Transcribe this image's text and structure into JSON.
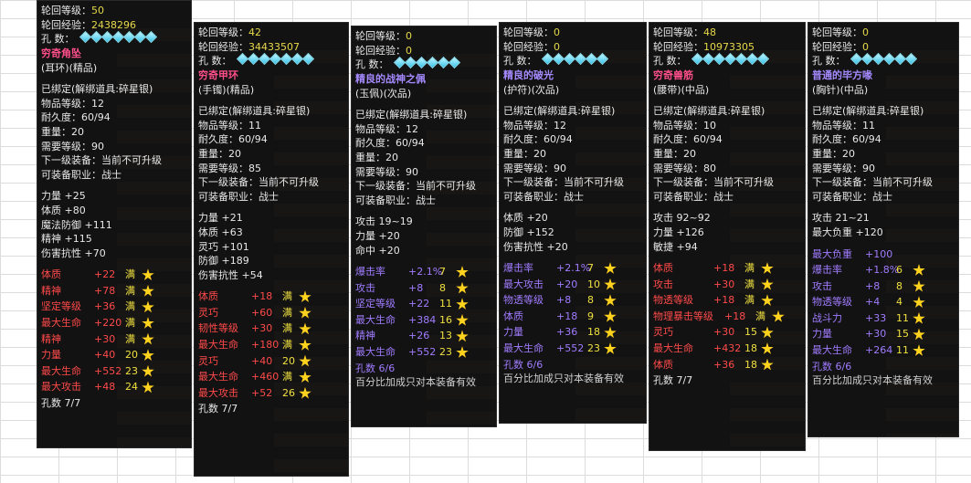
{
  "labels": {
    "reincarnation_level": "轮回等级：",
    "reincarnation_exp": "轮回经验：",
    "holes": "孔    数：",
    "bound": "已绑定(解绑道具:碎星银)",
    "item_level": "物品等级：",
    "durability": "耐久度：",
    "weight": "重量：",
    "required_level": "需要等级：",
    "next_equip": "下一级装备：",
    "next_equip_value": "当前不可升级",
    "profession": "可装备职业：",
    "profession_value": "战士",
    "full_mark": "满",
    "bonus_note": "百分比加成只对本装备有效"
  },
  "colors": {
    "red_name": "#ff4f8a",
    "purple_name": "#a58aff",
    "red_attr": "#ff4a4a",
    "purple_attr": "#a07cff",
    "gem": "#6fe3f5",
    "star": "#ffd21e"
  },
  "cards": [
    {
      "reinc_level": "50",
      "reinc_exp": "2438296",
      "name": "穷奇角坠",
      "sub": "(耳环)(精品)",
      "item_level": "12",
      "durability": "60/94",
      "weight": "20",
      "req_level": "90",
      "base": [
        "力量 +25",
        "体质 +80",
        "魔法防御 +111",
        "精神 +115",
        "伤害抗性 +70"
      ],
      "bonuses": [
        {
          "name": "体质",
          "val": "+22",
          "mark": "满"
        },
        {
          "name": "精神",
          "val": "+78",
          "mark": "满"
        },
        {
          "name": "坚定等级",
          "val": "+36",
          "mark": "满"
        },
        {
          "name": "最大生命",
          "val": "+220",
          "mark": "满"
        },
        {
          "name": "精神",
          "val": "+30",
          "mark": "满"
        },
        {
          "name": "力量",
          "val": "+40",
          "mark": "20"
        },
        {
          "name": "最大生命",
          "val": "+552",
          "mark": "23"
        },
        {
          "name": "最大攻击",
          "val": "+48",
          "mark": "24"
        }
      ],
      "holes_text": "孔数 7/7",
      "note": ""
    },
    {
      "reinc_level": "42",
      "reinc_exp": "34433507",
      "name": "穷奇甲环",
      "sub": "(手镯)(精品)",
      "item_level": "11",
      "durability": "60/94",
      "weight": "20",
      "req_level": "85",
      "base": [
        "力量 +21",
        "体质 +63",
        "灵巧 +101",
        "防御 +189",
        "伤害抗性 +54"
      ],
      "bonuses": [
        {
          "name": "体质",
          "val": "+18",
          "mark": "满"
        },
        {
          "name": "灵巧",
          "val": "+60",
          "mark": "满"
        },
        {
          "name": "韧性等级",
          "val": "+30",
          "mark": "满"
        },
        {
          "name": "最大生命",
          "val": "+180",
          "mark": "满"
        },
        {
          "name": "灵巧",
          "val": "+40",
          "mark": "20"
        },
        {
          "name": "最大生命",
          "val": "+460",
          "mark": "满"
        },
        {
          "name": "最大攻击",
          "val": "+52",
          "mark": "26"
        }
      ],
      "holes_text": "孔数 7/7",
      "note": ""
    },
    {
      "reinc_level": "0",
      "reinc_exp": "0",
      "name": "精良的战神之佩",
      "sub": "(玉佩)(次品)",
      "item_level": "12",
      "durability": "60/94",
      "weight": "20",
      "req_level": "90",
      "base": [
        "攻击 19~19",
        "力量 +20",
        "命中 +20"
      ],
      "bonuses": [
        {
          "name": "爆击率",
          "val": "+2.1%",
          "mark": "7"
        },
        {
          "name": "攻击",
          "val": "+8",
          "mark": "8"
        },
        {
          "name": "坚定等级",
          "val": "+22",
          "mark": "11"
        },
        {
          "name": "最大生命",
          "val": "+384",
          "mark": "16"
        },
        {
          "name": "精神",
          "val": "+26",
          "mark": "13"
        },
        {
          "name": "最大生命",
          "val": "+552",
          "mark": "23"
        }
      ],
      "holes_text": "孔数 6/6",
      "note": "百分比加成只对本装备有效"
    },
    {
      "reinc_level": "0",
      "reinc_exp": "0",
      "name": "精良的破光",
      "sub": "(护符)(次品)",
      "item_level": "12",
      "durability": "60/94",
      "weight": "20",
      "req_level": "90",
      "base": [
        "体质 +20",
        "防御 +152",
        "伤害抗性 +20"
      ],
      "bonuses": [
        {
          "name": "爆击率",
          "val": "+2.1%",
          "mark": "7"
        },
        {
          "name": "最大攻击",
          "val": "+20",
          "mark": "10"
        },
        {
          "name": "物透等级",
          "val": "+8",
          "mark": "8"
        },
        {
          "name": "体质",
          "val": "+18",
          "mark": "9"
        },
        {
          "name": "力量",
          "val": "+36",
          "mark": "18"
        },
        {
          "name": "最大生命",
          "val": "+552",
          "mark": "23"
        }
      ],
      "holes_text": "孔数 6/6",
      "note": "百分比加成只对本装备有效"
    },
    {
      "reinc_level": "48",
      "reinc_exp": "10973305",
      "name": "穷奇兽筋",
      "sub": "(腰带)(中品)",
      "item_level": "10",
      "durability": "60/94",
      "weight": "20",
      "req_level": "80",
      "base": [
        "攻击 92~92",
        "力量 +126",
        "敏捷 +94"
      ],
      "bonuses": [
        {
          "name": "体质",
          "val": "+18",
          "mark": "满"
        },
        {
          "name": "攻击",
          "val": "+30",
          "mark": "满"
        },
        {
          "name": "物透等级",
          "val": "+18",
          "mark": "满"
        },
        {
          "name": "物理暴击等级",
          "val": "+18",
          "mark": "满"
        },
        {
          "name": "灵巧",
          "val": "+30",
          "mark": "15"
        },
        {
          "name": "最大生命",
          "val": "+432",
          "mark": "18"
        },
        {
          "name": "体质",
          "val": "+36",
          "mark": "18"
        }
      ],
      "holes_text": "孔数 7/7",
      "note": ""
    },
    {
      "reinc_level": "0",
      "reinc_exp": "0",
      "name": "普通的毕方喙",
      "sub": "(胸针)(中品)",
      "item_level": "11",
      "durability": "60/94",
      "weight": "20",
      "req_level": "90",
      "base": [
        "攻击 21~21",
        "最大负重 +120"
      ],
      "bonuses": [
        {
          "name": "最大负重",
          "val": "+100",
          "mark": ""
        },
        {
          "name": "爆击率",
          "val": "+1.8%",
          "mark": "6"
        },
        {
          "name": "攻击",
          "val": "+8",
          "mark": "8"
        },
        {
          "name": "物透等级",
          "val": "+4",
          "mark": "4"
        },
        {
          "name": "战斗力",
          "val": "+33",
          "mark": "11"
        },
        {
          "name": "力量",
          "val": "+30",
          "mark": "15"
        },
        {
          "name": "最大生命",
          "val": "+264",
          "mark": "11"
        }
      ],
      "holes_text": "孔数 6/6",
      "note": "百分比加成只对本装备有效"
    }
  ]
}
